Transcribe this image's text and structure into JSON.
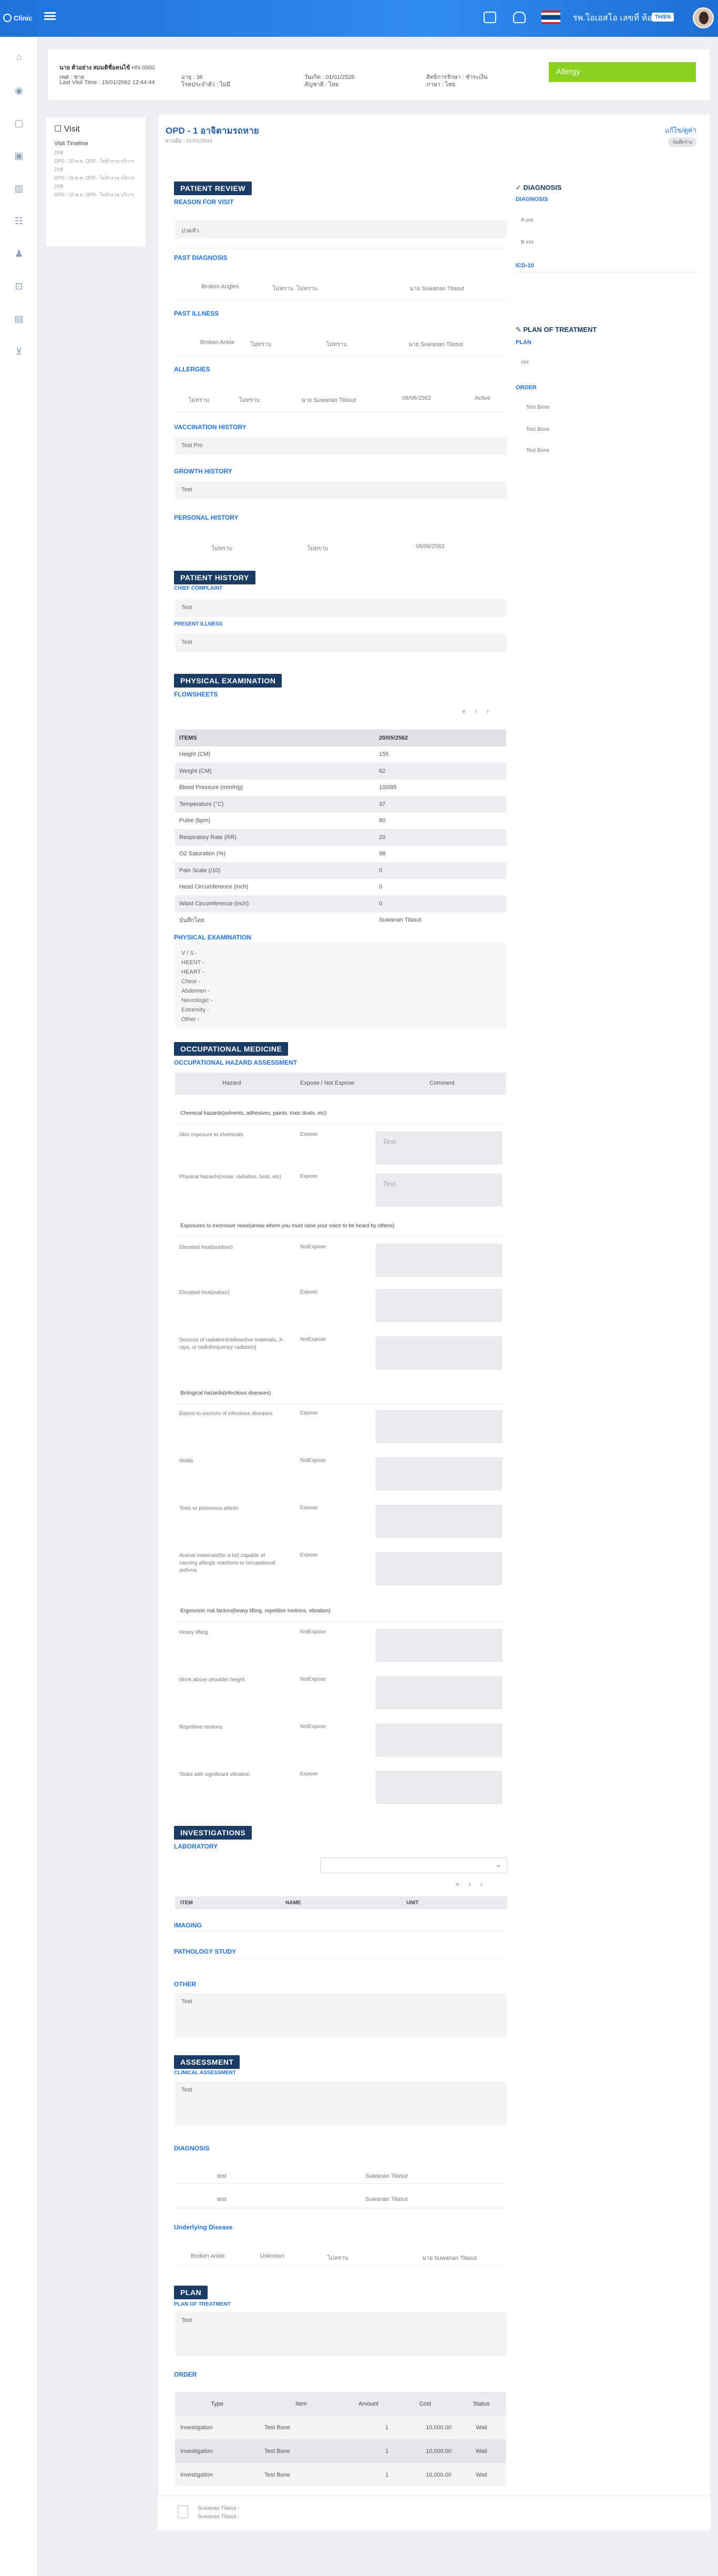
{
  "brand": "Clinic",
  "header": {
    "username": "รพ.โอเอสโอ เลขที่ ห้อง",
    "lang": "TH/EN"
  },
  "patient": {
    "name_label": "นาย",
    "name": "ตัวอย่าง สมมติชื่อคนไข้",
    "hn": "HN-0000",
    "sex_label": "เพศ :",
    "sex": "ชาย",
    "age_label": "อายุ :",
    "age": "36",
    "dob_label": "วันเกิด :",
    "dob": "01/01/2526",
    "rights_label": "สิทธิการรักษา :",
    "rights": "ชำระเงิน",
    "lastvisit_label": "Last Visit Time :",
    "lastvisit": "15/01/2562 12:44:44",
    "congenital_label": "โรคประจำตัว :",
    "congenital": "ไม่มี",
    "nationality_label": "สัญชาติ :",
    "nationality": "ไทย",
    "language_label": "ภาษา :",
    "language": "ไทย",
    "allergy": "Allergy"
  },
  "visit": {
    "title": "Visit",
    "timeline": "Visit Timeline",
    "items": [
      {
        "date": "2/08",
        "text": "OPD - 20 พ.ค. OPD - ไม่ทำงาน บริการ"
      },
      {
        "date": "2/08",
        "text": "OPD - 15 พ.ค. OPD - ไม่ทำงาน บริการ"
      },
      {
        "date": "2/08",
        "text": "OPD - 10 พ.ค. OPD - ไม่ทำงาน บริการ"
      }
    ]
  },
  "opd": {
    "title": "OPD - 1 อาจิตามรถหาย",
    "subtitle": "ผ่านมือ : 01/01/2544",
    "edit": "แก้ไข/ดูค่า",
    "badge": "บันทึกร่าง"
  },
  "review": {
    "header": "PATIENT REVIEW",
    "reason_title": "REASON FOR VISIT",
    "reason": "ปวดหัว",
    "past_dx_title": "PAST DIAGNOSIS",
    "past_dx": [
      "Broken Angles",
      "ไม่ทราบ",
      "ไม่ทราบ",
      "นาย Suwanan Tilasut"
    ],
    "past_ill_title": "PAST ILLNESS",
    "past_ill": [
      "Broken Ankle",
      "ไม่ทราบ",
      "ไม่ทราบ",
      "นาย Suwanan Tilasut"
    ],
    "allergies_title": "ALLERGIES",
    "allergies": [
      "ไม่ทราบ",
      "ไม่ทราบ",
      "นาย Suwanan Tilasut",
      "06/06/2562",
      "Active"
    ],
    "vacc_title": "VACCINATION HISTORY",
    "vacc": "Test Pro",
    "growth_title": "GROWTH HISTORY",
    "growth": "Test",
    "personal_title": "PERSONAL HISTORY",
    "personal": [
      "ไม่ทราบ",
      "ไม่ทราบ",
      "06/06/2562"
    ]
  },
  "history": {
    "header": "PATIENT HISTORY",
    "cc_title": "CHIEF COMPLAINT",
    "cc": "Test",
    "pi_title": "PRESENT ILLNESS",
    "pi": "Test"
  },
  "physical": {
    "header": "PHYSICAL EXAMINATION",
    "flow_title": "FLOWSHEETS",
    "pager": [
      "«",
      "‹",
      "›"
    ],
    "col_item": "ITEMS",
    "col_date": "20/05/2562",
    "rows": [
      [
        "Height (CM)",
        "155"
      ],
      [
        "Weight (CM)",
        "62"
      ],
      [
        "Blood Pressure (mm/Hg)",
        "100/85"
      ],
      [
        "Temperature (°C)",
        "37"
      ],
      [
        "Pulse (bpm)",
        "80"
      ],
      [
        "Respiratory Rate (RR)",
        "20"
      ],
      [
        "O2 Saturation (%)",
        "98"
      ],
      [
        "Pain Scale (/10)",
        "0"
      ],
      [
        "Head Circumference (inch)",
        "0"
      ],
      [
        "Waist Circumference (inch)",
        "0"
      ],
      [
        "บันทึกโดย",
        "Suwanan Tilasut"
      ]
    ],
    "pe_title": "PHYSICAL EXAMINATION",
    "pe_lines": [
      "V / S -",
      "HEENT -",
      "HEART -",
      "Chest -",
      "Abdomen -",
      "Neurologic -",
      "Extremity -",
      "Other -"
    ]
  },
  "occ": {
    "header": "OCCUPATIONAL MEDICINE",
    "title": "OCCUPATIONAL HAZARD ASSESSMENT",
    "cols": [
      "Hazard",
      "Expose / Not Expose",
      "Comment"
    ],
    "cat1": "Chemical hazards(solvents, adhesives, paints, toxic dusts, etc)",
    "r1": {
      "h": "Skin exposure to chemicals",
      "e": "Expose",
      "c": "Text"
    },
    "r2": {
      "h": "Physical hazards(noise, radiation, heat, etc)",
      "e": "Expose",
      "c": "Text"
    },
    "cat2": "Exposures to excessive noise(areas where you must raise your voice to be heard by others).",
    "r3": {
      "h": "Elevated heat(outdoor)",
      "e": "NotExpose"
    },
    "r4": {
      "h": "Elevated heat(indoor)",
      "e": "Expose"
    },
    "r5": {
      "h": "Sources of radiation(radioactive materials, X-rays, or radiofrequency radiation)",
      "e": "NotExpose"
    },
    "cat3": "Biological hazards(infectious diseases)",
    "r6": {
      "h": "Exposi to sources of infectious diseases",
      "e": "Expose"
    },
    "r7": {
      "h": "Molds",
      "e": "NotExpose"
    },
    "r8": {
      "h": "Toxic or poisonous plants",
      "e": "Expose"
    },
    "r9": {
      "h": "Animal materials(for a lot) capable of causing allergic reactions or occupational asthma",
      "e": "Expose"
    },
    "cat4": "Ergonomic risk factors(heavy lifting, repetitive motions, vibration)",
    "r10": {
      "h": "Heavy lifting",
      "e": "NotExpose"
    },
    "r11": {
      "h": "Work above shoulder height",
      "e": "NotExpose"
    },
    "r12": {
      "h": "Repetitive motions",
      "e": "NotExpose"
    },
    "r13": {
      "h": "Tasks with significant vibration",
      "e": "Expose"
    }
  },
  "inv": {
    "header": "INVESTIGATIONS",
    "lab_title": "LABORATORY",
    "pager": [
      "«",
      "‹",
      "›"
    ],
    "cols": [
      "ITEM",
      "NAME",
      "UNIT"
    ],
    "imaging": "IMAGING",
    "patho": "PATHOLOGY STUDY",
    "other": "OTHER",
    "other_text": "Test"
  },
  "assess": {
    "header": "ASSESSMENT",
    "clin_title": "CLINICAL ASSESSMENT",
    "clin": "Test",
    "dx_title": "DIAGNOSIS",
    "dx": [
      [
        "test",
        "Suwanan Tilasut"
      ],
      [
        "test",
        "Suwanan Tilasut"
      ]
    ],
    "ud_title": "Underlying Disease",
    "ud": [
      "Broken Ankle",
      "Unknown",
      "ไม่ทราบ",
      "นาย Suwanan Tilasut"
    ]
  },
  "plan": {
    "header": "PLAN",
    "pot_title": "PLAN OF TREATMENT",
    "pot": "Test",
    "order_title": "ORDER",
    "cols": [
      "Type",
      "Item",
      "Amount",
      "Cost",
      "Status"
    ],
    "rows": [
      [
        "Investigation",
        "Test Bone",
        "1",
        "10,000.00",
        "Wait"
      ],
      [
        "Investigation",
        "Test Bone",
        "1",
        "10,000.00",
        "Wait"
      ],
      [
        "Investigation",
        "Test Bone",
        "1",
        "10,000.00",
        "Wait"
      ]
    ]
  },
  "right": {
    "dx_title": "DIAGNOSIS",
    "dx_sub": "DIAGNOSIS",
    "dx_items": [
      "A xxx",
      "B xxx"
    ],
    "icd": "ICD-10",
    "plan_title": "PLAN OF TREATMENT",
    "plan_sub": "PLAN",
    "plan_item": "xxx",
    "order_sub": "ORDER",
    "orders": [
      "Test Bone",
      "Test Bone",
      "Test Bone"
    ]
  },
  "footer": {
    "line1": "Suwanan Tilasut -",
    "line2": "Suwanan Tilasut -"
  }
}
